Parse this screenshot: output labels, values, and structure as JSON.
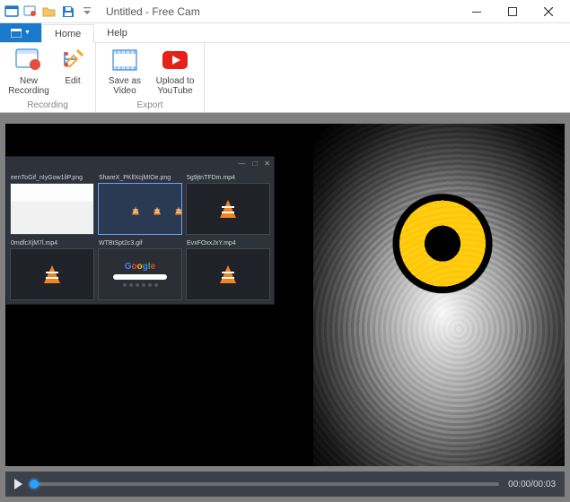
{
  "titlebar": {
    "title": "Untitled - Free Cam"
  },
  "qat": {
    "dropdown_aria": "Customize Quick Access Toolbar"
  },
  "tabs": {
    "file": "",
    "home": "Home",
    "help": "Help"
  },
  "ribbon": {
    "recording": {
      "label": "Recording",
      "new_recording": "New\nRecording",
      "edit": "Edit"
    },
    "export": {
      "label": "Export",
      "save_as_video": "Save as\nVideo",
      "upload_to_youtube": "Upload to\nYouTube"
    }
  },
  "explorer": {
    "files": [
      {
        "name": "eenToGif_nIyGow1liP.png",
        "thumb": "ss1"
      },
      {
        "name": "ShareX_PKllXcjMIOe.png",
        "thumb": "ss2",
        "selected": true
      },
      {
        "name": "5g9jtnTFDm.mp4",
        "thumb": "vlc"
      },
      {
        "name": "0mdfcXjM7l.mp4",
        "thumb": "vlc"
      },
      {
        "name": "WTBtSpt2c3.gif",
        "thumb": "google"
      },
      {
        "name": "EvxFOxxJxY.mp4",
        "thumb": "vlc"
      }
    ]
  },
  "player": {
    "time": "00:00/00:03"
  }
}
